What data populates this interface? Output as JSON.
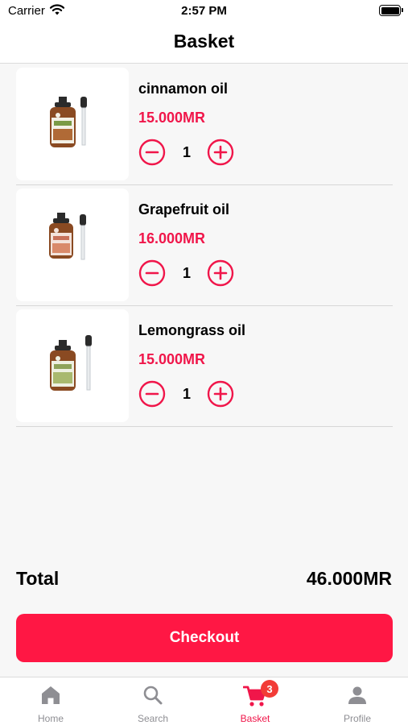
{
  "status_bar": {
    "carrier": "Carrier",
    "time": "2:57 PM"
  },
  "header": {
    "title": "Basket"
  },
  "items": [
    {
      "name": "cinnamon oil",
      "price": "15.000MR",
      "quantity": "1",
      "label_color": "#7a9a45"
    },
    {
      "name": "Grapefruit oil",
      "price": "16.000MR",
      "quantity": "1",
      "label_color": "#c8725a"
    },
    {
      "name": "Lemongrass oil",
      "price": "15.000MR",
      "quantity": "1",
      "label_color": "#8ea35a"
    }
  ],
  "total": {
    "label": "Total",
    "value": "46.000MR"
  },
  "checkout": {
    "label": "Checkout"
  },
  "tab_bar": {
    "tabs": [
      {
        "label": "Home",
        "icon": "home-icon"
      },
      {
        "label": "Search",
        "icon": "search-icon"
      },
      {
        "label": "Basket",
        "icon": "cart-icon",
        "badge": "3",
        "active": true
      },
      {
        "label": "Profile",
        "icon": "person-icon"
      }
    ]
  },
  "colors": {
    "accent": "#f0164a",
    "button": "#ff1744",
    "badge": "#f23c37",
    "inactive": "#8e8e93"
  }
}
